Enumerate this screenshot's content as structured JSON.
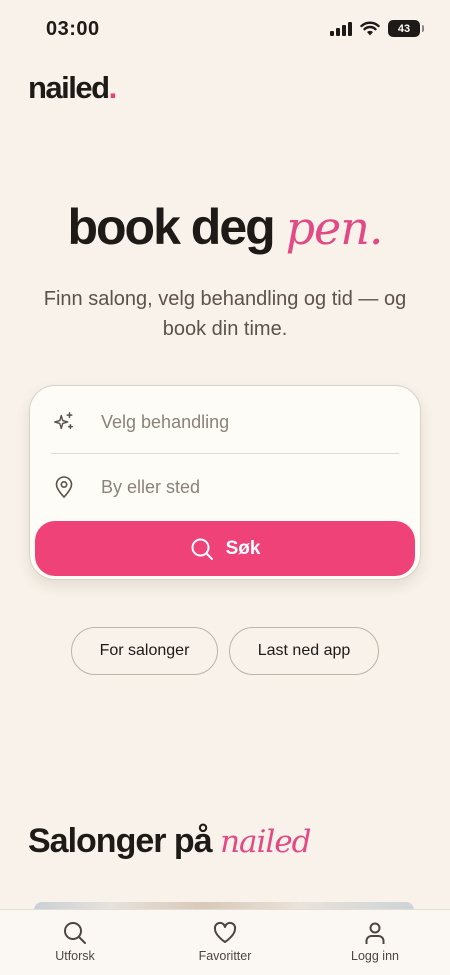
{
  "status": {
    "time": "03:00",
    "battery": "43"
  },
  "brand": {
    "name": "nailed",
    "dot": ".",
    "accent_color": "#ec3f7a"
  },
  "hero": {
    "title_main": "book deg",
    "title_accent": "pen.",
    "subtitle": "Finn salong, velg behandling og tid — og book din time."
  },
  "search": {
    "treatment_placeholder": "Velg behandling",
    "location_placeholder": "By eller sted",
    "button_label": "Søk",
    "button_color": "#ee4279"
  },
  "links": {
    "for_salons": "For salonger",
    "download_app": "Last ned app"
  },
  "section": {
    "title_main": "Salonger på",
    "title_accent": "nailed"
  },
  "tabs": [
    {
      "label": "Utforsk",
      "icon": "search-icon"
    },
    {
      "label": "Favoritter",
      "icon": "heart-icon"
    },
    {
      "label": "Logg inn",
      "icon": "user-icon"
    }
  ]
}
